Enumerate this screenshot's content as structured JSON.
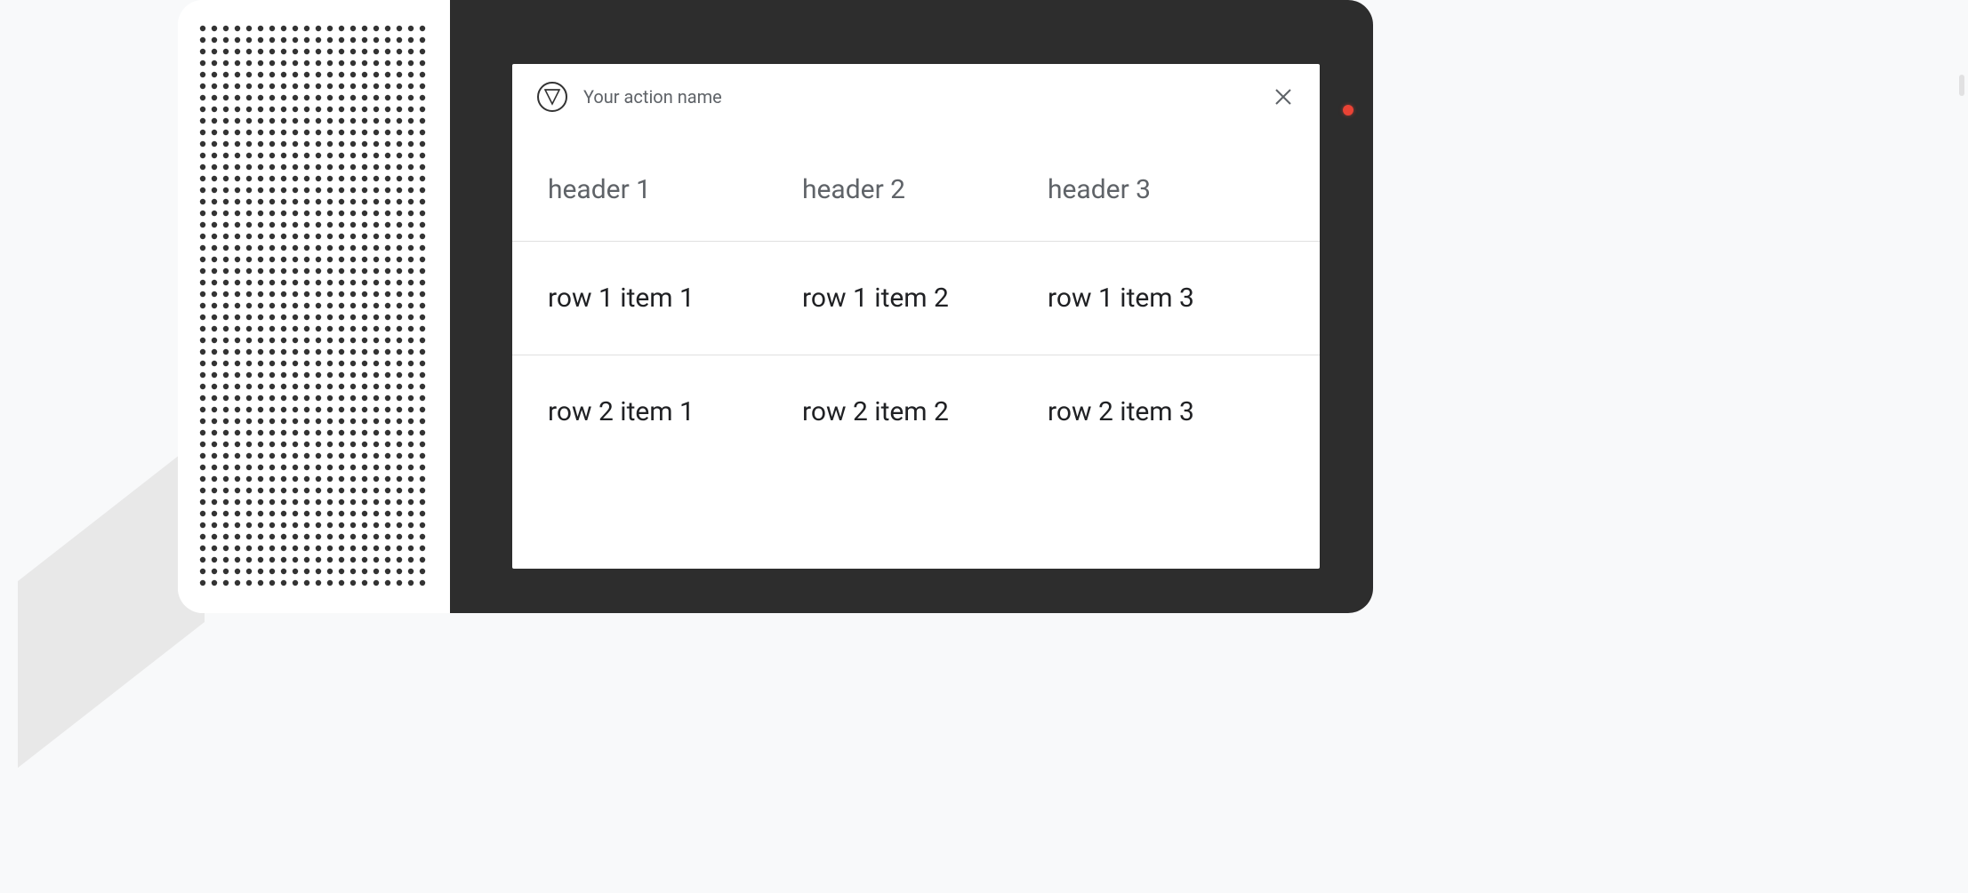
{
  "action": {
    "name": "Your action name"
  },
  "table": {
    "headers": [
      "header 1",
      "header 2",
      "header 3"
    ],
    "rows": [
      [
        "row 1 item 1",
        "row 1 item 2",
        "row 1 item 3"
      ],
      [
        "row 2 item 1",
        "row 2 item 2",
        "row 2 item 3"
      ]
    ]
  }
}
